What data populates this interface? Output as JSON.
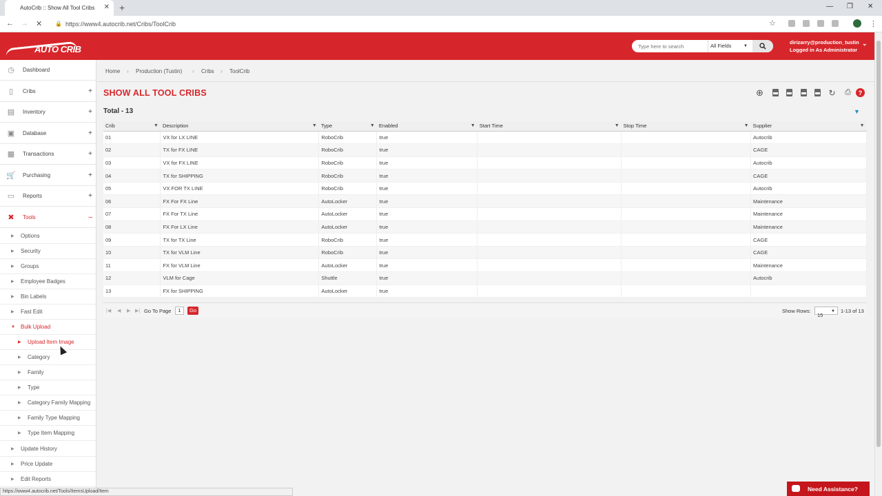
{
  "browser": {
    "tab_title": "AutoCrib :: Show All Tool Cribs",
    "url": "https://www4.autocrib.net/Cribs/ToolCrib",
    "status_url": "https://www4.autocrib.net/Tools/ItemsUpload/Item"
  },
  "header": {
    "logo_text": "AUTO CRIB",
    "search_placeholder": "Type here to search",
    "search_scope": "All Fields",
    "user_email": "dirizarry@production_tustin",
    "user_role": "Logged in As Administrator"
  },
  "sidebar": {
    "items": [
      {
        "label": "Dashboard",
        "icon": "dashboard-icon",
        "expand": ""
      },
      {
        "label": "Cribs",
        "icon": "cribs-icon",
        "expand": "+"
      },
      {
        "label": "Inventory",
        "icon": "inventory-icon",
        "expand": "+"
      },
      {
        "label": "Database",
        "icon": "database-icon",
        "expand": "+"
      },
      {
        "label": "Transactions",
        "icon": "transactions-icon",
        "expand": "+"
      },
      {
        "label": "Purchasing",
        "icon": "cart-icon",
        "expand": "+"
      },
      {
        "label": "Reports",
        "icon": "reports-icon",
        "expand": "+"
      },
      {
        "label": "Tools",
        "icon": "tools-icon",
        "expand": "–"
      }
    ],
    "tools_sub": [
      "Options",
      "Security",
      "Groups",
      "Employee Badges",
      "Bin Labels",
      "Fast Edit",
      "Bulk Upload"
    ],
    "bulk_sub": [
      "Upload Item Image",
      "Category",
      "Family",
      "Type",
      "Category Family Mapping",
      "Family Type Mapping",
      "Type Item Mapping"
    ],
    "tools_sub2": [
      "Update History",
      "Price Update",
      "Edit Reports"
    ]
  },
  "breadcrumb": [
    "Home",
    "Production (Tustin)",
    "Cribs",
    "ToolCrib"
  ],
  "page": {
    "title": "SHOW ALL TOOL CRIBS",
    "total": "Total - 13"
  },
  "grid": {
    "columns": [
      "Crib",
      "Description",
      "Type",
      "Enabled",
      "Start Time",
      "Stop Time",
      "Supplier"
    ],
    "rows": [
      [
        "01",
        "VX for LX LINE",
        "RoboCrib",
        "true",
        "",
        "",
        "Autocrib"
      ],
      [
        "02",
        "TX for FX LINE",
        "RoboCrib",
        "true",
        "",
        "",
        "CAGE"
      ],
      [
        "03",
        "VX for FX LINE",
        "RoboCrib",
        "true",
        "",
        "",
        "Autocrib"
      ],
      [
        "04",
        "TX for SHIPPING",
        "RoboCrib",
        "true",
        "",
        "",
        "CAGE"
      ],
      [
        "05",
        "VX FOR TX LINE",
        "RoboCrib",
        "true",
        "",
        "",
        "Autocrib"
      ],
      [
        "06",
        "FX For FX Line",
        "AutoLocker",
        "true",
        "",
        "",
        "Maintenance"
      ],
      [
        "07",
        "FX For TX Line",
        "AutoLocker",
        "true",
        "",
        "",
        "Maintenance"
      ],
      [
        "08",
        "FX For LX Line",
        "AutoLocker",
        "true",
        "",
        "",
        "Maintenance"
      ],
      [
        "09",
        "TX for TX Line",
        "RoboCrib",
        "true",
        "",
        "",
        "CAGE"
      ],
      [
        "10",
        "TX for VLM Line",
        "RoboCrib",
        "true",
        "",
        "",
        "CAGE"
      ],
      [
        "11",
        "FX for VLM Line",
        "AutoLocker",
        "true",
        "",
        "",
        "Maintenance"
      ],
      [
        "12",
        "VLM for Cage",
        "Shuttle",
        "true",
        "",
        "",
        "Autocrib"
      ],
      [
        "13",
        "FX for SHIPPING",
        "AutoLocker",
        "true",
        "",
        "",
        ""
      ]
    ]
  },
  "pager": {
    "go_to_page": "Go To Page",
    "page": "1",
    "go": "Go",
    "show_rows": "Show Rows:",
    "rows": "15",
    "range": "1-13 of 13"
  },
  "assist": "Need Assistance?"
}
